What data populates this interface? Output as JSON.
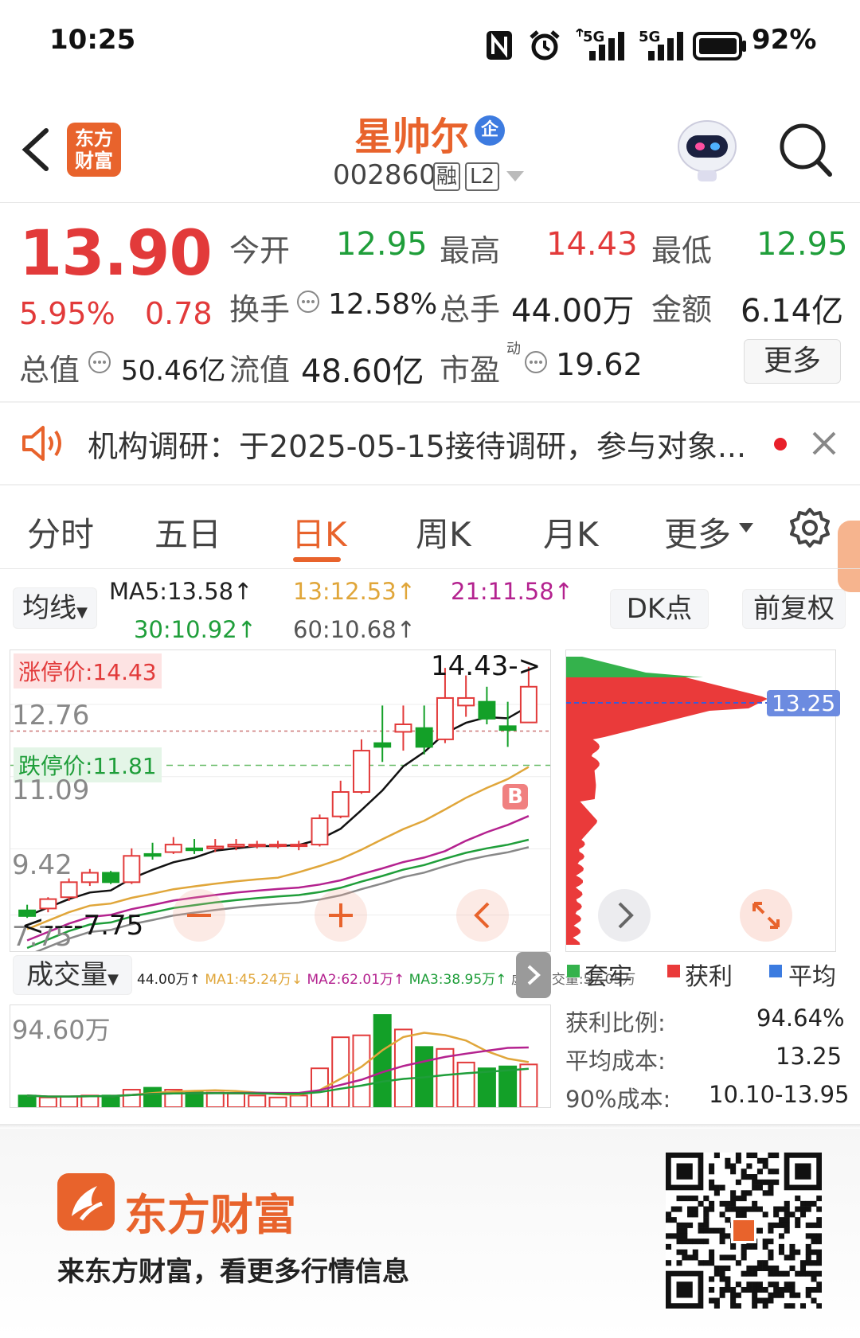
{
  "status_bar": {
    "time": "10:25",
    "signal1": "5G",
    "signal2": "5G",
    "battery": "92%"
  },
  "header": {
    "logo_text": "东方财富",
    "stock_name": "星帅尔",
    "badge": "企",
    "code": "002860",
    "tags": [
      "融",
      "L2"
    ]
  },
  "quote": {
    "price": "13.90",
    "pct": "5.95%",
    "change": "0.78",
    "open_label": "今开",
    "open": "12.95",
    "high_label": "最高",
    "high": "14.43",
    "low_label": "最低",
    "low": "12.95",
    "turnover_label": "换手",
    "turnover": "12.58%",
    "volume_label": "总手",
    "volume": "44.00万",
    "amount_label": "金额",
    "amount": "6.14亿",
    "mktcap_label": "总值",
    "mktcap": "50.46亿",
    "float_label": "流值",
    "float": "48.60亿",
    "pe_label": "市盈",
    "pe_sup": "动",
    "pe": "19.62",
    "more_button": "更多"
  },
  "notice": {
    "text": "机构调研：于2025-05-15接待调研，参与对象..."
  },
  "tabs": [
    "分时",
    "五日",
    "日K",
    "周K",
    "月K",
    "更多"
  ],
  "active_tab": "日K",
  "ma_bar": {
    "type_select": "均线",
    "ma5": "MA5:13.58↑",
    "ma13": "13:12.53↑",
    "ma21": "21:11.58↑",
    "ma30": "30:10.92↑",
    "ma60": "60:10.68↑",
    "dk_button": "DK点",
    "adjust_button": "前复权"
  },
  "kline": {
    "limit_up": "涨停价:14.43",
    "limit_down": "跌停价:11.81",
    "y_labels": [
      "12.76",
      "11.09",
      "9.42",
      "7.75"
    ],
    "high_marker": "14.43->",
    "low_marker": "<----7.75",
    "buy_marker": "B"
  },
  "chip": {
    "price_tag": "13.25",
    "legend": [
      "套牢",
      "获利",
      "平均"
    ],
    "profit_ratio_label": "获利比例:",
    "profit_ratio": "94.64%",
    "avg_cost_label": "平均成本:",
    "avg_cost": "13.25",
    "cost90_label": "90%成本:",
    "cost90": "10.10-13.95"
  },
  "volume": {
    "select": "成交量",
    "info": [
      "44.00万↑",
      "MA1:45.24万↓",
      "MA2:62.01万↑",
      "MA3:38.95万↑",
      "虚拟成交量:57.05万"
    ],
    "top_label": "94.60万"
  },
  "footer": {
    "brand": "东方财富",
    "slogan": "来东方财富，看更多行情信息"
  },
  "colors": {
    "up": "#e23a3a",
    "down": "#13a028",
    "accent": "#e8632c"
  },
  "chart_data": {
    "type": "candlestick",
    "candles": [
      {
        "o": 7.95,
        "c": 7.8,
        "h": 8.1,
        "l": 7.75
      },
      {
        "o": 8.0,
        "c": 8.25,
        "h": 8.3,
        "l": 7.9
      },
      {
        "o": 8.3,
        "c": 8.7,
        "h": 8.8,
        "l": 8.2
      },
      {
        "o": 8.7,
        "c": 8.95,
        "h": 9.05,
        "l": 8.6
      },
      {
        "o": 8.95,
        "c": 8.7,
        "h": 9.0,
        "l": 8.65
      },
      {
        "o": 8.7,
        "c": 9.4,
        "h": 9.6,
        "l": 8.65
      },
      {
        "o": 9.45,
        "c": 9.4,
        "h": 9.75,
        "l": 9.3
      },
      {
        "o": 9.5,
        "c": 9.7,
        "h": 9.9,
        "l": 9.45
      },
      {
        "o": 9.6,
        "c": 9.55,
        "h": 9.85,
        "l": 9.45
      },
      {
        "o": 9.6,
        "c": 9.65,
        "h": 9.85,
        "l": 9.5
      },
      {
        "o": 9.65,
        "c": 9.7,
        "h": 9.85,
        "l": 9.55
      },
      {
        "o": 9.7,
        "c": 9.7,
        "h": 9.8,
        "l": 9.6
      },
      {
        "o": 9.7,
        "c": 9.7,
        "h": 9.8,
        "l": 9.6
      },
      {
        "o": 9.7,
        "c": 9.7,
        "h": 9.8,
        "l": 9.55
      },
      {
        "o": 9.7,
        "c": 10.4,
        "h": 10.5,
        "l": 9.65
      },
      {
        "o": 10.45,
        "c": 11.1,
        "h": 11.4,
        "l": 10.4
      },
      {
        "o": 11.1,
        "c": 12.2,
        "h": 12.5,
        "l": 11.05
      },
      {
        "o": 12.4,
        "c": 12.3,
        "h": 13.4,
        "l": 11.9
      },
      {
        "o": 12.7,
        "c": 12.9,
        "h": 13.4,
        "l": 12.2
      },
      {
        "o": 12.8,
        "c": 12.3,
        "h": 13.4,
        "l": 12.1
      },
      {
        "o": 12.5,
        "c": 13.6,
        "h": 14.4,
        "l": 12.4
      },
      {
        "o": 13.4,
        "c": 13.6,
        "h": 14.2,
        "l": 13.1
      },
      {
        "o": 13.5,
        "c": 13.05,
        "h": 13.9,
        "l": 12.9
      },
      {
        "o": 12.85,
        "c": 12.75,
        "h": 13.5,
        "l": 12.3
      },
      {
        "o": 12.95,
        "c": 13.9,
        "h": 14.43,
        "l": 12.95
      }
    ],
    "volume_values": [
      12,
      10,
      11,
      12,
      12,
      18,
      20,
      18,
      16,
      15,
      14,
      12,
      10,
      12,
      40,
      72,
      74,
      95,
      80,
      62,
      60,
      46,
      40,
      42,
      44
    ],
    "ylim": [
      7.5,
      14.7
    ]
  }
}
